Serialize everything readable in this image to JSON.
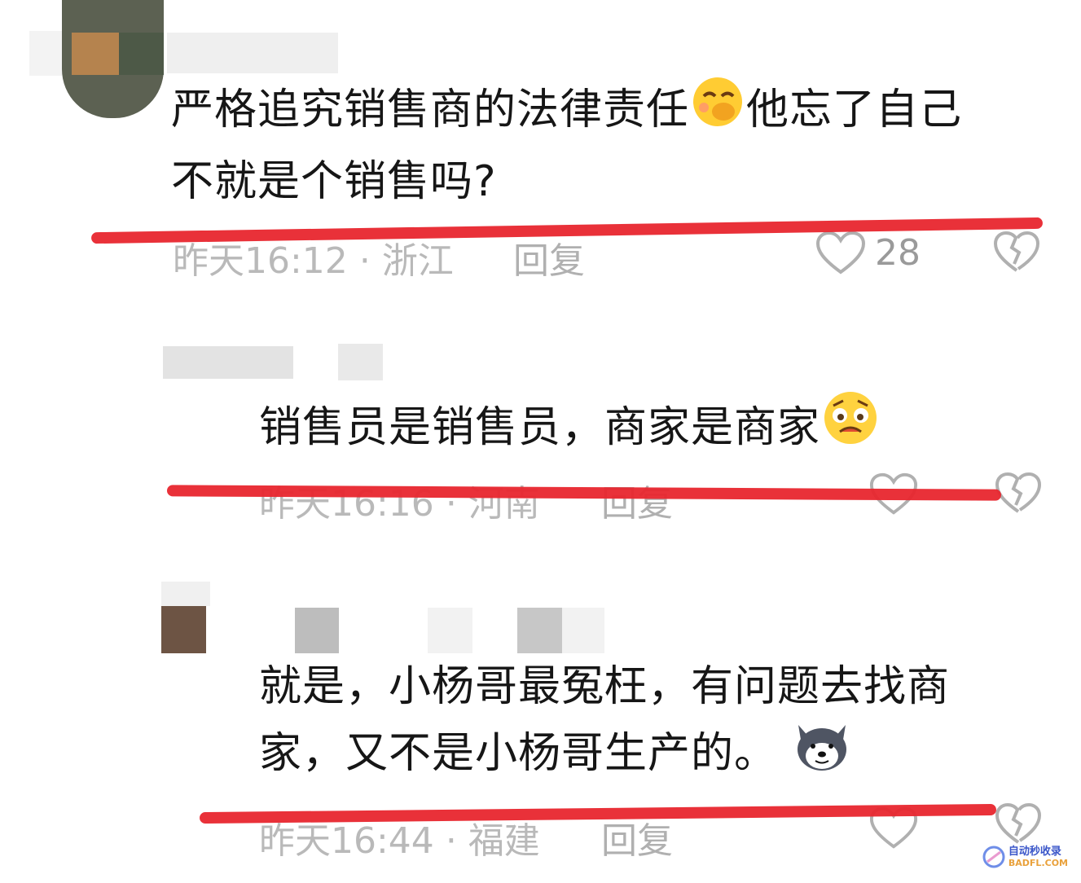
{
  "comments": [
    {
      "text_line1": "严格追究销售商的法律责任",
      "text_line1b": "他忘了自己",
      "text_line2": "不就是个销售吗?",
      "emoji": "shy-laugh-emoji",
      "time": "昨天16:12",
      "location": "浙江",
      "reply": "回复",
      "likes": "28"
    },
    {
      "text_line1": "销售员是销售员，商家是商家",
      "emoji": "worried-face-emoji",
      "time": "昨天16:16",
      "location": "河南",
      "reply": "回复",
      "likes": ""
    },
    {
      "text_line1": "就是，小杨哥最冤枉，有问题去找商",
      "text_line2": "家，又不是小杨哥生产的。",
      "emoji": "husky-dog-emoji",
      "time": "昨天16:44",
      "location": "福建",
      "reply": "回复",
      "likes": ""
    }
  ],
  "separator": "·",
  "watermark": {
    "line1": "自动秒收录",
    "line2": "BADFL.COM"
  },
  "colors": {
    "strike_red": "#e8262e",
    "meta_gray": "#b9b9b9",
    "text": "#161616"
  }
}
